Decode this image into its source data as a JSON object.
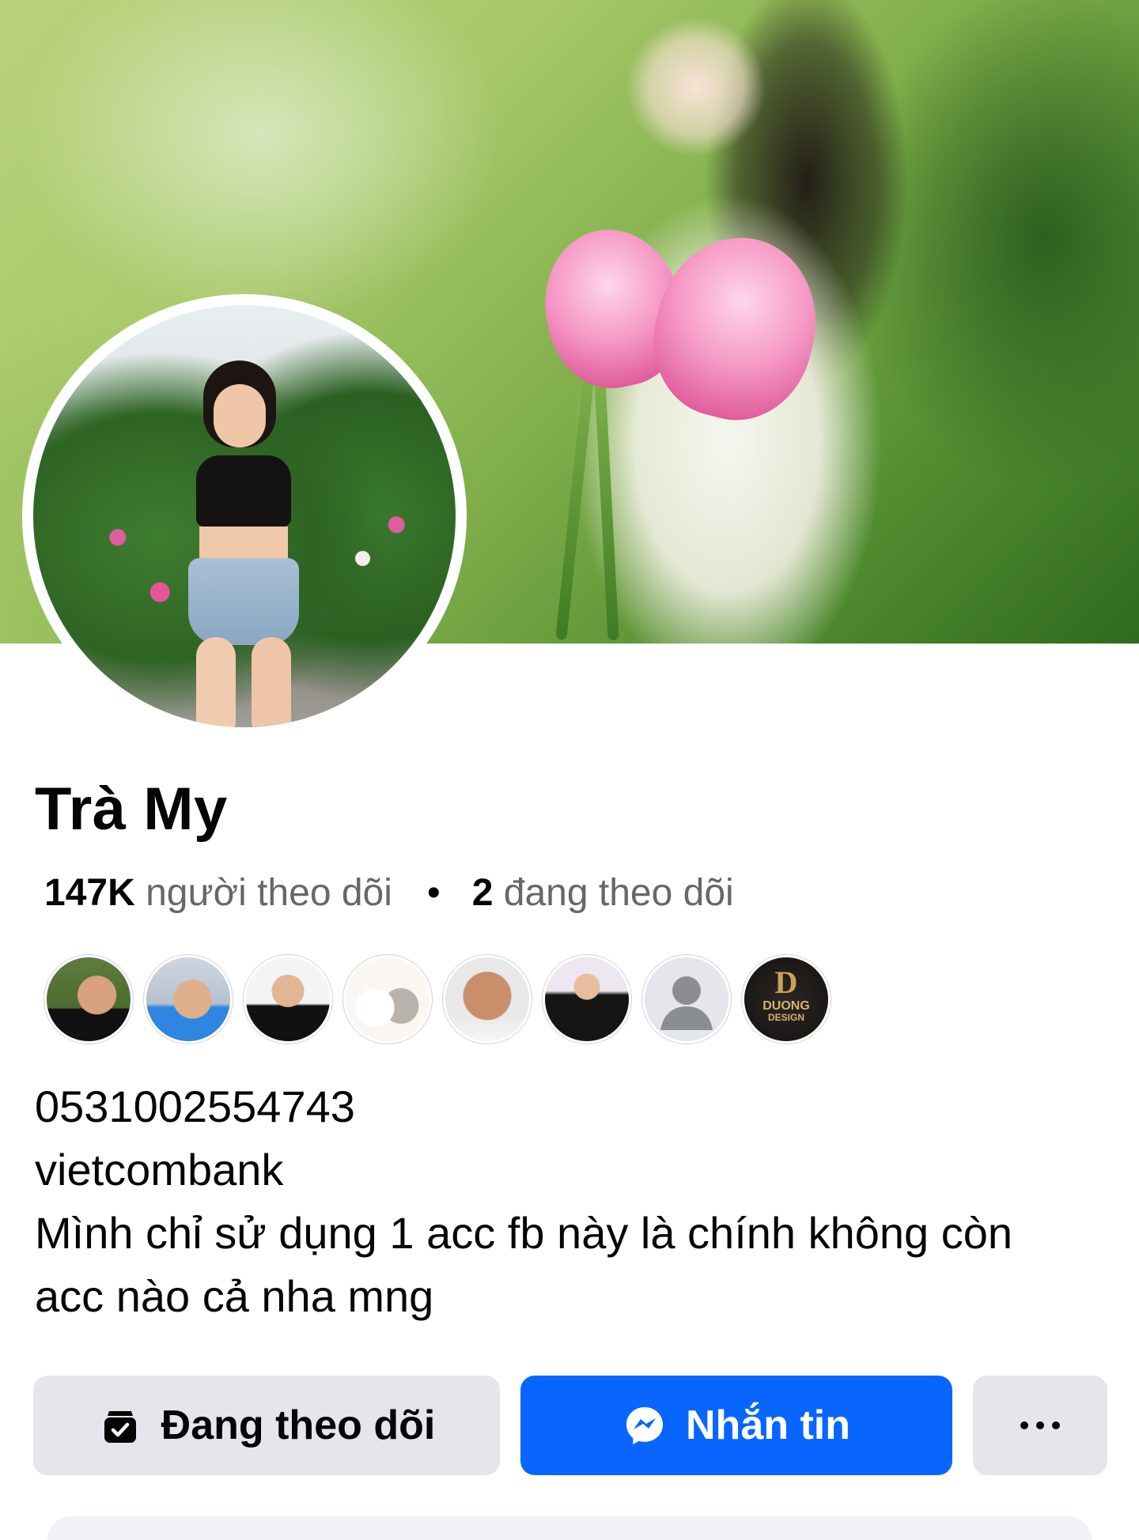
{
  "profile": {
    "name": "Trà My",
    "followers_count": "147K",
    "followers_label": "người theo dõi",
    "separator": "•",
    "following_count": "2",
    "following_label": "đang theo dõi"
  },
  "friends_preview": {
    "logo_letter": "D",
    "logo_name": "DUONG",
    "logo_sub": "DESIGN"
  },
  "bio": {
    "line1": "0531002554743",
    "line2": "vietcombank",
    "line3": "Mình chỉ sử dụng 1 acc fb này là chính không còn",
    "line4": "acc nào cả nha mng"
  },
  "actions": {
    "follow_label": "Đang theo dõi",
    "message_label": "Nhắn tin"
  },
  "icons": {
    "follow": "following-bag-check-icon",
    "message": "messenger-icon",
    "more": "more-horizontal-icon",
    "placeholder_avatar": "default-person-icon"
  },
  "colors": {
    "primary": "#0866ff",
    "secondary_button": "#e4e6eb",
    "text": "#050505",
    "muted_text": "#65676b"
  }
}
